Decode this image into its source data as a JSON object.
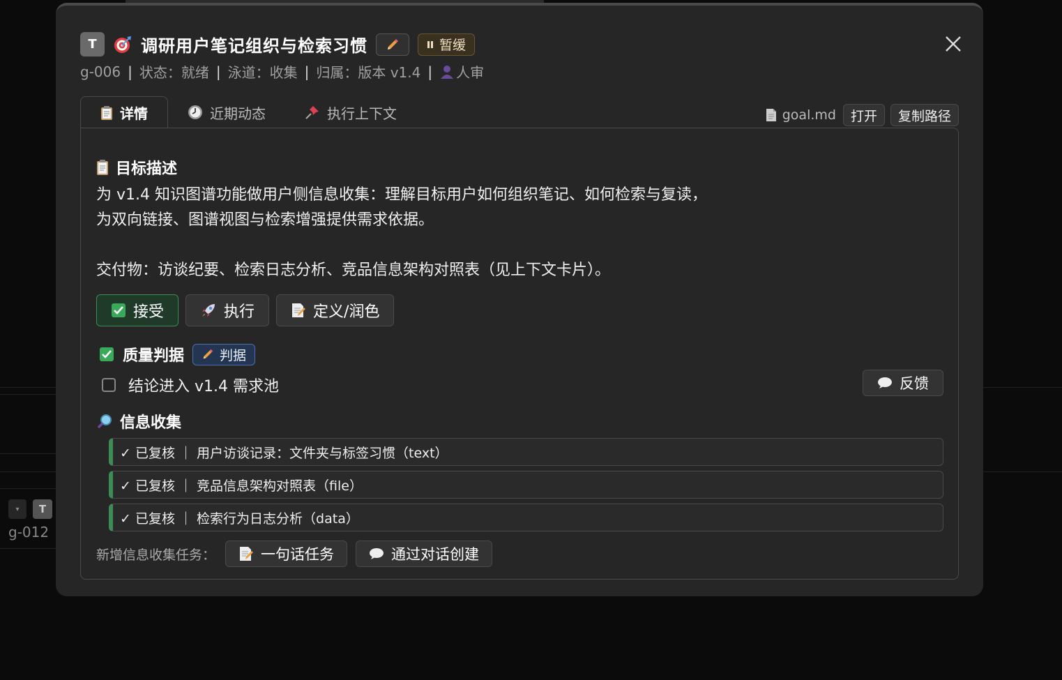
{
  "background": {
    "row_id": "g-012",
    "row_badge": "T"
  },
  "modal": {
    "type_badge": "T",
    "title": "调研用户笔记组织与检索习惯",
    "status_badge": "暂缓",
    "meta": {
      "id": "g-006",
      "state": "状态：就绪",
      "lane": "泳道：收集",
      "belongs": "归属：版本 v1.4",
      "reviewer": "人审",
      "separator": "|"
    },
    "tabs": [
      {
        "label": "详情",
        "icon": "clipboard-icon",
        "active": true
      },
      {
        "label": "近期动态",
        "icon": "clock-icon",
        "active": false
      },
      {
        "label": "执行上下文",
        "icon": "pushpin-icon",
        "active": false
      }
    ],
    "file": {
      "name": "goal.md",
      "open_label": "打开",
      "copy_label": "复制路径"
    },
    "description": {
      "heading": "目标描述",
      "text": "为 v1.4 知识图谱功能做用户侧信息收集：理解目标用户如何组织笔记、如何检索与复读，\n为双向链接、图谱视图与检索增强提供需求依据。\n\n交付物：访谈纪要、检索日志分析、竞品信息架构对照表（见上下文卡片）。"
    },
    "actions": {
      "accept": "接受",
      "execute": "执行",
      "define": "定义/润色"
    },
    "quality": {
      "heading": "质量判据",
      "verdict_label": "判据",
      "criterion": "结论进入 v1.4 需求池",
      "criterion_checked": false,
      "feedback_label": "反馈"
    },
    "info": {
      "heading": "信息收集",
      "items": [
        "✓ 已复核 ｜ 用户访谈记录：文件夹与标签习惯（text）",
        "✓ 已复核 ｜ 竞品信息架构对照表（file）",
        "✓ 已复核 ｜ 检索行为日志分析（data）"
      ],
      "new_label": "新增信息收集任务：",
      "new_one_liner": "一句话任务",
      "new_dialog": "通过对话创建"
    },
    "colors": {
      "accent_green": "#3e8b55",
      "pause_bg": "#3a3020",
      "verdict_blue": "#243552"
    }
  }
}
